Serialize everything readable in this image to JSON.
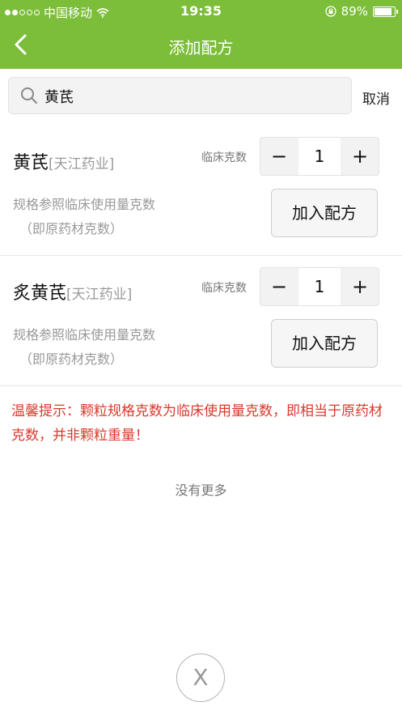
{
  "status_bar": {
    "carrier": "中国移动",
    "time": "19:35",
    "battery_text": "89%",
    "battery_level": 0.89,
    "signal_bars_filled": 2,
    "signal_bars_total": 5,
    "icons": [
      "signal-icon",
      "wifi-icon",
      "orientation-lock-icon",
      "battery-icon"
    ]
  },
  "nav": {
    "title": "添加配方",
    "back_icon": "chevron-left-icon",
    "bar_color": "#7cbd3a"
  },
  "search": {
    "icon": "search-icon",
    "value": "黄芪",
    "cancel_label": "取消"
  },
  "results": [
    {
      "name": "黄芪",
      "brand": "[天江药业]",
      "dosage_label": "临床克数",
      "minus": "−",
      "quantity": "1",
      "plus": "+",
      "spec_line1": "规格参照临床使用量克数",
      "spec_line2": "（即原药材克数）",
      "add_label": "加入配方"
    },
    {
      "name": "炙黄芪",
      "brand": "[天江药业]",
      "dosage_label": "临床克数",
      "minus": "−",
      "quantity": "1",
      "plus": "+",
      "spec_line1": "规格参照临床使用量克数",
      "spec_line2": "（即原药材克数）",
      "add_label": "加入配方"
    }
  ],
  "tip": {
    "text": "温馨提示：颗粒规格克数为临床使用量克数，即相当于原药材克数，并非颗粒重量！",
    "color": "#d9392c"
  },
  "no_more": "没有更多",
  "close_button": {
    "label": "X"
  }
}
